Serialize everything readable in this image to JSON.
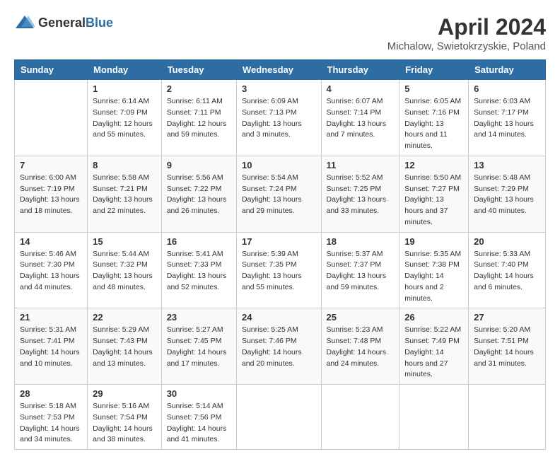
{
  "header": {
    "logo_general": "General",
    "logo_blue": "Blue",
    "title": "April 2024",
    "subtitle": "Michalow, Swietokrzyskie, Poland"
  },
  "calendar": {
    "days_of_week": [
      "Sunday",
      "Monday",
      "Tuesday",
      "Wednesday",
      "Thursday",
      "Friday",
      "Saturday"
    ],
    "weeks": [
      {
        "days": [
          {
            "date": "",
            "sunrise": "",
            "sunset": "",
            "daylight": ""
          },
          {
            "date": "1",
            "sunrise": "Sunrise: 6:14 AM",
            "sunset": "Sunset: 7:09 PM",
            "daylight": "Daylight: 12 hours and 55 minutes."
          },
          {
            "date": "2",
            "sunrise": "Sunrise: 6:11 AM",
            "sunset": "Sunset: 7:11 PM",
            "daylight": "Daylight: 12 hours and 59 minutes."
          },
          {
            "date": "3",
            "sunrise": "Sunrise: 6:09 AM",
            "sunset": "Sunset: 7:13 PM",
            "daylight": "Daylight: 13 hours and 3 minutes."
          },
          {
            "date": "4",
            "sunrise": "Sunrise: 6:07 AM",
            "sunset": "Sunset: 7:14 PM",
            "daylight": "Daylight: 13 hours and 7 minutes."
          },
          {
            "date": "5",
            "sunrise": "Sunrise: 6:05 AM",
            "sunset": "Sunset: 7:16 PM",
            "daylight": "Daylight: 13 hours and 11 minutes."
          },
          {
            "date": "6",
            "sunrise": "Sunrise: 6:03 AM",
            "sunset": "Sunset: 7:17 PM",
            "daylight": "Daylight: 13 hours and 14 minutes."
          }
        ]
      },
      {
        "days": [
          {
            "date": "7",
            "sunrise": "Sunrise: 6:00 AM",
            "sunset": "Sunset: 7:19 PM",
            "daylight": "Daylight: 13 hours and 18 minutes."
          },
          {
            "date": "8",
            "sunrise": "Sunrise: 5:58 AM",
            "sunset": "Sunset: 7:21 PM",
            "daylight": "Daylight: 13 hours and 22 minutes."
          },
          {
            "date": "9",
            "sunrise": "Sunrise: 5:56 AM",
            "sunset": "Sunset: 7:22 PM",
            "daylight": "Daylight: 13 hours and 26 minutes."
          },
          {
            "date": "10",
            "sunrise": "Sunrise: 5:54 AM",
            "sunset": "Sunset: 7:24 PM",
            "daylight": "Daylight: 13 hours and 29 minutes."
          },
          {
            "date": "11",
            "sunrise": "Sunrise: 5:52 AM",
            "sunset": "Sunset: 7:25 PM",
            "daylight": "Daylight: 13 hours and 33 minutes."
          },
          {
            "date": "12",
            "sunrise": "Sunrise: 5:50 AM",
            "sunset": "Sunset: 7:27 PM",
            "daylight": "Daylight: 13 hours and 37 minutes."
          },
          {
            "date": "13",
            "sunrise": "Sunrise: 5:48 AM",
            "sunset": "Sunset: 7:29 PM",
            "daylight": "Daylight: 13 hours and 40 minutes."
          }
        ]
      },
      {
        "days": [
          {
            "date": "14",
            "sunrise": "Sunrise: 5:46 AM",
            "sunset": "Sunset: 7:30 PM",
            "daylight": "Daylight: 13 hours and 44 minutes."
          },
          {
            "date": "15",
            "sunrise": "Sunrise: 5:44 AM",
            "sunset": "Sunset: 7:32 PM",
            "daylight": "Daylight: 13 hours and 48 minutes."
          },
          {
            "date": "16",
            "sunrise": "Sunrise: 5:41 AM",
            "sunset": "Sunset: 7:33 PM",
            "daylight": "Daylight: 13 hours and 52 minutes."
          },
          {
            "date": "17",
            "sunrise": "Sunrise: 5:39 AM",
            "sunset": "Sunset: 7:35 PM",
            "daylight": "Daylight: 13 hours and 55 minutes."
          },
          {
            "date": "18",
            "sunrise": "Sunrise: 5:37 AM",
            "sunset": "Sunset: 7:37 PM",
            "daylight": "Daylight: 13 hours and 59 minutes."
          },
          {
            "date": "19",
            "sunrise": "Sunrise: 5:35 AM",
            "sunset": "Sunset: 7:38 PM",
            "daylight": "Daylight: 14 hours and 2 minutes."
          },
          {
            "date": "20",
            "sunrise": "Sunrise: 5:33 AM",
            "sunset": "Sunset: 7:40 PM",
            "daylight": "Daylight: 14 hours and 6 minutes."
          }
        ]
      },
      {
        "days": [
          {
            "date": "21",
            "sunrise": "Sunrise: 5:31 AM",
            "sunset": "Sunset: 7:41 PM",
            "daylight": "Daylight: 14 hours and 10 minutes."
          },
          {
            "date": "22",
            "sunrise": "Sunrise: 5:29 AM",
            "sunset": "Sunset: 7:43 PM",
            "daylight": "Daylight: 14 hours and 13 minutes."
          },
          {
            "date": "23",
            "sunrise": "Sunrise: 5:27 AM",
            "sunset": "Sunset: 7:45 PM",
            "daylight": "Daylight: 14 hours and 17 minutes."
          },
          {
            "date": "24",
            "sunrise": "Sunrise: 5:25 AM",
            "sunset": "Sunset: 7:46 PM",
            "daylight": "Daylight: 14 hours and 20 minutes."
          },
          {
            "date": "25",
            "sunrise": "Sunrise: 5:23 AM",
            "sunset": "Sunset: 7:48 PM",
            "daylight": "Daylight: 14 hours and 24 minutes."
          },
          {
            "date": "26",
            "sunrise": "Sunrise: 5:22 AM",
            "sunset": "Sunset: 7:49 PM",
            "daylight": "Daylight: 14 hours and 27 minutes."
          },
          {
            "date": "27",
            "sunrise": "Sunrise: 5:20 AM",
            "sunset": "Sunset: 7:51 PM",
            "daylight": "Daylight: 14 hours and 31 minutes."
          }
        ]
      },
      {
        "days": [
          {
            "date": "28",
            "sunrise": "Sunrise: 5:18 AM",
            "sunset": "Sunset: 7:53 PM",
            "daylight": "Daylight: 14 hours and 34 minutes."
          },
          {
            "date": "29",
            "sunrise": "Sunrise: 5:16 AM",
            "sunset": "Sunset: 7:54 PM",
            "daylight": "Daylight: 14 hours and 38 minutes."
          },
          {
            "date": "30",
            "sunrise": "Sunrise: 5:14 AM",
            "sunset": "Sunset: 7:56 PM",
            "daylight": "Daylight: 14 hours and 41 minutes."
          },
          {
            "date": "",
            "sunrise": "",
            "sunset": "",
            "daylight": ""
          },
          {
            "date": "",
            "sunrise": "",
            "sunset": "",
            "daylight": ""
          },
          {
            "date": "",
            "sunrise": "",
            "sunset": "",
            "daylight": ""
          },
          {
            "date": "",
            "sunrise": "",
            "sunset": "",
            "daylight": ""
          }
        ]
      }
    ]
  }
}
